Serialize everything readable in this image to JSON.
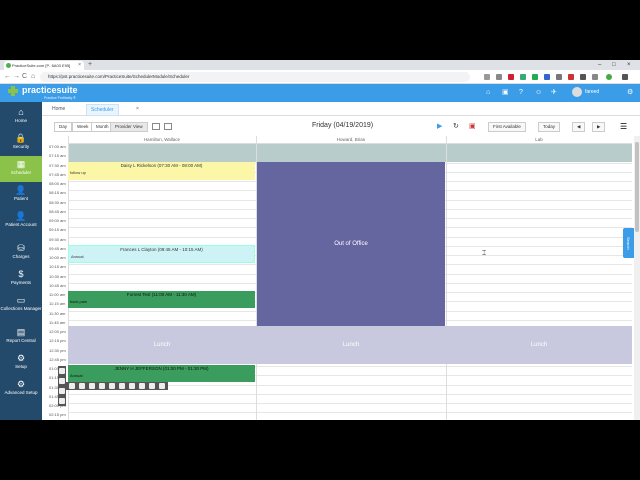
{
  "browser": {
    "tab_title": "PracticeSuite.com [P- 6A03 E95]",
    "tab_close": "×",
    "new_tab": "+",
    "url": "https://pst.practicesuite.com/PracticeSuite/SchedulerModule/Scheduler",
    "nav": {
      "back": "←",
      "forward": "→",
      "reload": "C",
      "home": "⌂"
    },
    "window_controls": [
      "–",
      "□",
      "×"
    ]
  },
  "app": {
    "logo_text": "practicesuite",
    "logo_sub": "Practice Profitably ®",
    "user_name": "fareed",
    "header_icons": [
      "⌂",
      "▣",
      "?",
      "☺",
      "✈",
      "⚙"
    ]
  },
  "sidebar": {
    "items": [
      {
        "label": "Home",
        "icon": "⌂"
      },
      {
        "label": "Security",
        "icon": "🔒"
      },
      {
        "label": "Scheduler",
        "icon": "▦"
      },
      {
        "label": "Patient",
        "icon": "👤"
      },
      {
        "label": "Patient Account",
        "icon": "👤"
      },
      {
        "label": "Charges",
        "icon": "⛁"
      },
      {
        "label": "Payments",
        "icon": "$"
      },
      {
        "label": "Collections Manager",
        "icon": "▭"
      },
      {
        "label": "Report Central",
        "icon": "▤"
      },
      {
        "label": "Setup",
        "icon": "⚙"
      },
      {
        "label": "Advanced Setup",
        "icon": "⚙"
      }
    ]
  },
  "tabs": [
    {
      "label": "Home"
    },
    {
      "label": "Scheduler"
    }
  ],
  "tab_close": "×",
  "toolbar": {
    "views": [
      "Day",
      "Week",
      "Month",
      "Provider View"
    ],
    "date_title": "Friday (04/19/2019)",
    "first_available": "First Available",
    "today": "Today",
    "prev": "◀",
    "next": "▶",
    "menu": "☰"
  },
  "columns": [
    "Hamilton, Wallace",
    "Howard, Brian",
    "Lab"
  ],
  "times": [
    "07:00 am",
    "07:15 am",
    "07:30 am",
    "07:45 am",
    "08:00 am",
    "08:15 am",
    "08:30 am",
    "08:45 am",
    "09:00 am",
    "09:15 am",
    "09:30 am",
    "09:45 am",
    "10:00 am",
    "10:15 am",
    "10:30 am",
    "10:45 am",
    "11:00 am",
    "11:15 am",
    "11:30 am",
    "11:45 am",
    "12:00 pm",
    "12:15 pm",
    "12:30 pm",
    "12:45 pm",
    "01:00 pm",
    "01:15 pm",
    "01:30 pm",
    "01:45 pm",
    "02:00 pm",
    "02:15 pm"
  ],
  "appointments": [
    {
      "title": "Daisy L Rickelson (07:30 AM - 08:00 AM)",
      "note": "follow up",
      "color": "#fbf7a6"
    },
    {
      "title": "Frances L Clayton (09:45 AM - 10:15 AM)",
      "note": "Annual",
      "color": "#cdf3f7"
    },
    {
      "title": "Forrest Test (11:00 AM - 11:30 AM)",
      "note": "back pain",
      "color": "#3a9d5d"
    },
    {
      "title": "JENNY H JEFFERSON (01:00 PM - 01:30 PM)",
      "note": "Annual",
      "color": "#3a9d5d"
    }
  ],
  "out_of_office": "Out of Office",
  "lunch": [
    "Lunch",
    "Lunch",
    "Lunch"
  ],
  "search_tab": "Search",
  "colors": {
    "header": "#3b9ce8",
    "sidebar": "#234a6b",
    "active": "#8bc34a",
    "ooo": "#6565a0",
    "lunch": "#c8c9de"
  }
}
